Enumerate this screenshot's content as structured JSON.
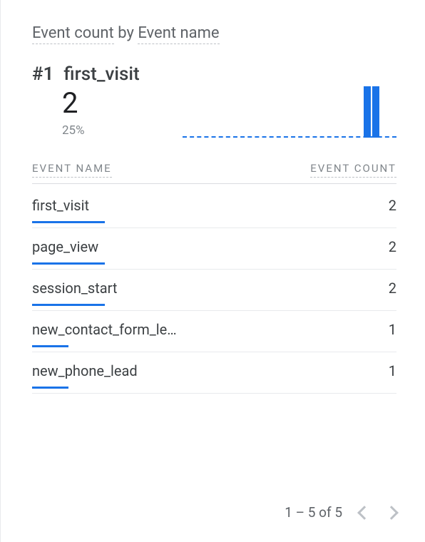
{
  "title": {
    "metric": "Event count",
    "by": " by ",
    "dimension": "Event name"
  },
  "hero": {
    "rank": "#1",
    "name": "first_visit",
    "value": "2",
    "pct": "25%"
  },
  "headers": {
    "name": "EVENT NAME",
    "count": "EVENT COUNT"
  },
  "rows": [
    {
      "name": "first_visit",
      "count": "2",
      "barPct": 20
    },
    {
      "name": "page_view",
      "count": "2",
      "barPct": 20
    },
    {
      "name": "session_start",
      "count": "2",
      "barPct": 20
    },
    {
      "name": "new_contact_form_le…",
      "count": "1",
      "barPct": 10
    },
    {
      "name": "new_phone_lead",
      "count": "1",
      "barPct": 10
    }
  ],
  "sparkline": {
    "bars": [
      {
        "rightPx": 36,
        "heightPct": 90
      },
      {
        "rightPx": 24,
        "heightPct": 90
      }
    ]
  },
  "pager": {
    "range": "1 – 5 of 5"
  },
  "chart_data": {
    "type": "bar",
    "title": "Event count by Event name",
    "xlabel": "Event name",
    "ylabel": "Event count",
    "categories": [
      "first_visit",
      "page_view",
      "session_start",
      "new_contact_form_lead",
      "new_phone_lead"
    ],
    "values": [
      2,
      2,
      2,
      1,
      1
    ],
    "top_pct_of_total": 25,
    "ylim": [
      0,
      2
    ]
  }
}
